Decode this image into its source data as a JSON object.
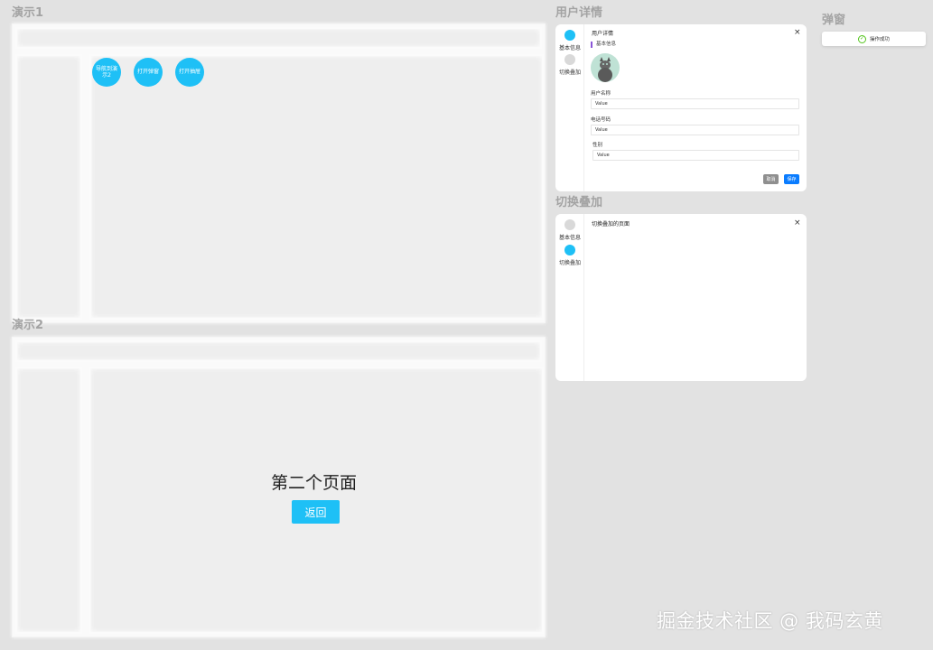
{
  "demo1": {
    "title": "演示1",
    "buttons": [
      "导航到演示2",
      "打开弹窗",
      "打开抽屉"
    ]
  },
  "demo2": {
    "title": "演示2",
    "heading": "第二个页面",
    "back_label": "返回"
  },
  "user_detail": {
    "section_title": "用户详情",
    "nav": [
      "基本信息",
      "切换叠加"
    ],
    "dialog_title": "用户详情",
    "close": "×",
    "sub_heading": "基本信息",
    "fields": [
      {
        "label": "用户名称",
        "value": "Value"
      },
      {
        "label": "电话号码",
        "value": "Value"
      },
      {
        "label": "性别",
        "value": "Value"
      }
    ],
    "cancel_label": "取消",
    "save_label": "保存"
  },
  "overlay": {
    "section_title": "切换叠加",
    "nav": [
      "基本信息",
      "切换叠加"
    ],
    "dialog_title": "切换叠加的页面",
    "close": "×"
  },
  "popup": {
    "section_title": "弹窗",
    "toast_text": "操作成功",
    "toast_icon": "check-circle-icon"
  },
  "watermark": "掘金技术社区 @ 我码玄黄",
  "colors": {
    "accent": "#1ec0f6",
    "primary_button": "#0a7cff",
    "success": "#52c41a",
    "sub_heading_bar": "#8a55d8"
  }
}
